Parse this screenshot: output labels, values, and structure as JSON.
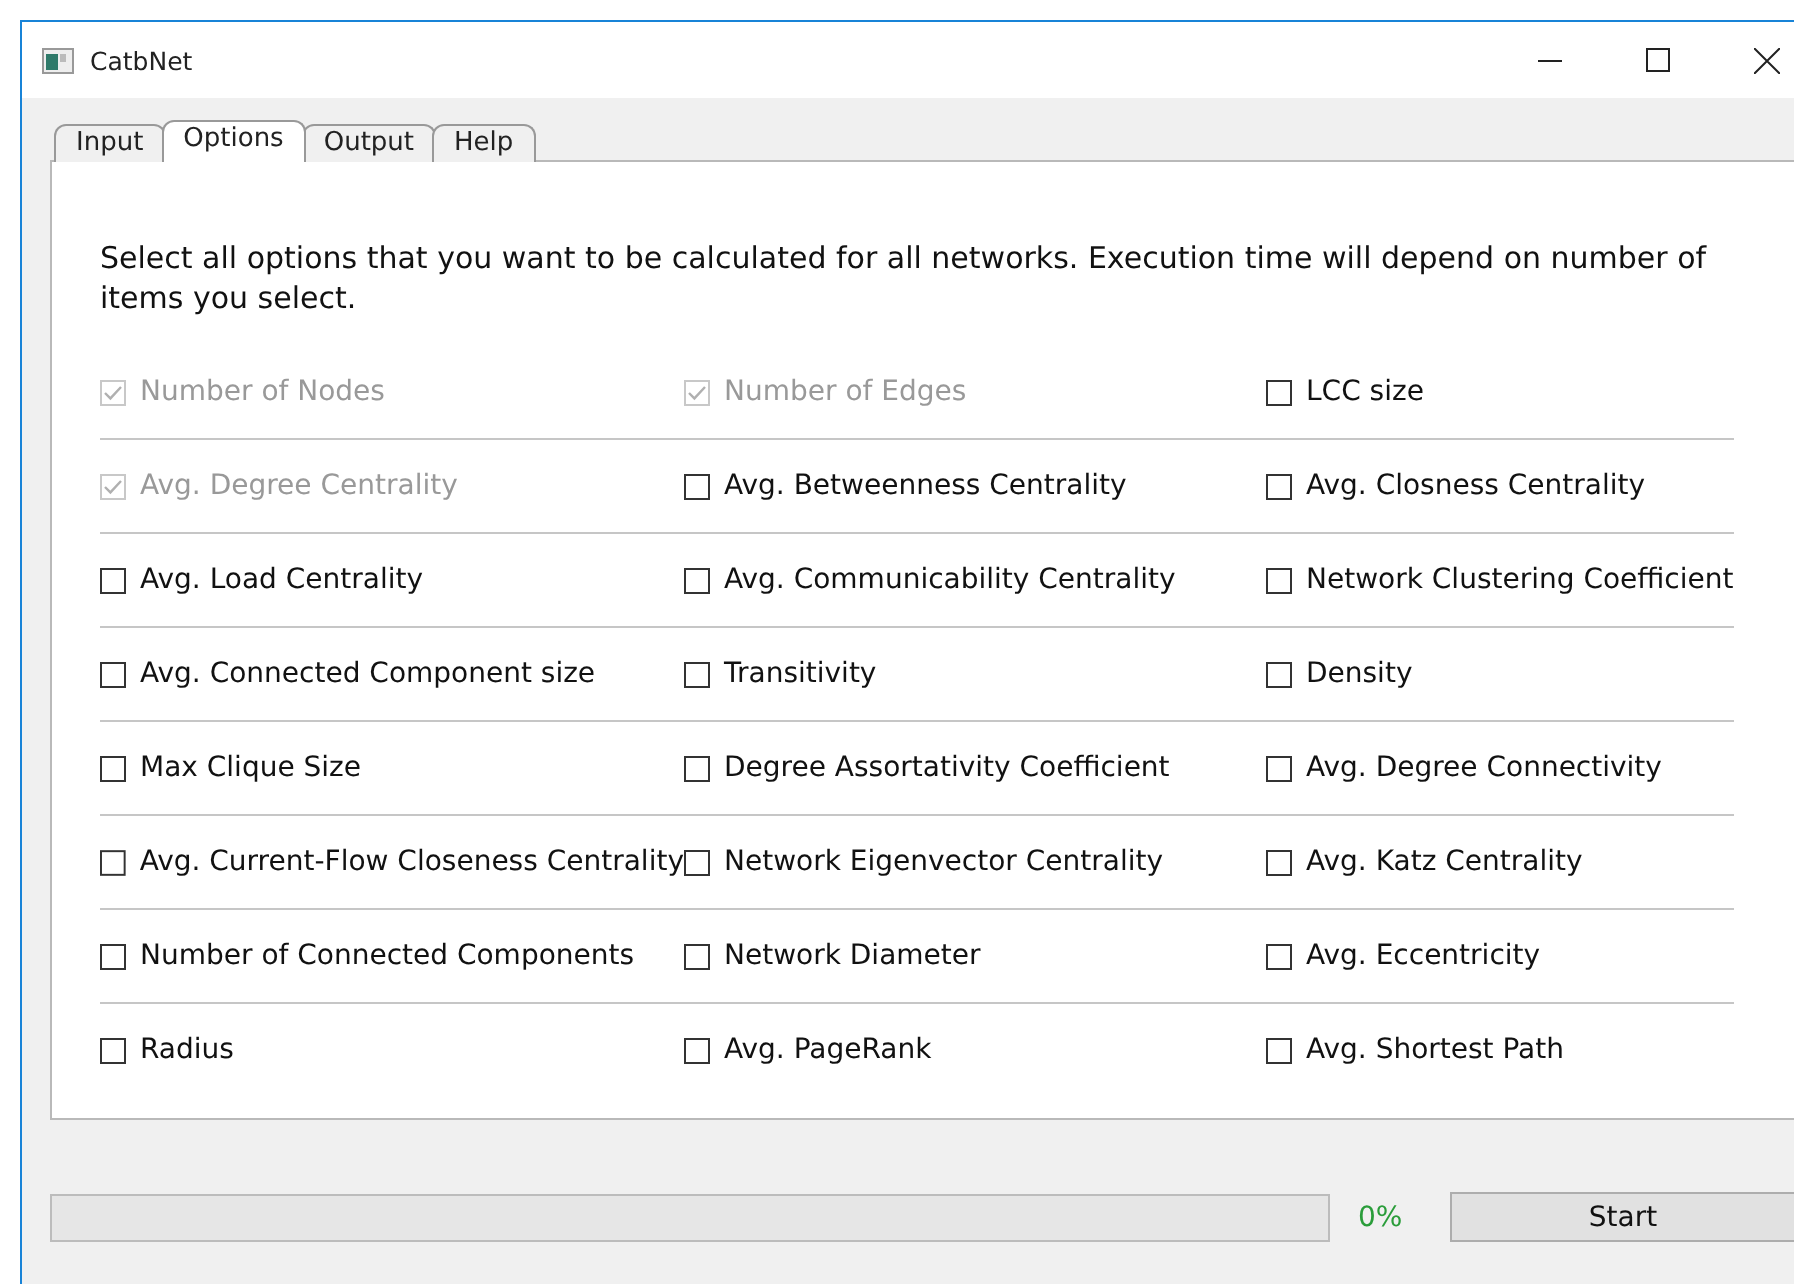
{
  "window": {
    "title": "CatbNet"
  },
  "tabs": [
    {
      "label": "Input",
      "selected": false
    },
    {
      "label": "Options",
      "selected": true
    },
    {
      "label": "Output",
      "selected": false
    },
    {
      "label": "Help",
      "selected": false
    }
  ],
  "instructions": "Select all options that you want to be calculated for all networks. Execution time will depend on number of items you select.",
  "option_rows": [
    [
      {
        "label": "Number of Nodes",
        "checked": true,
        "disabled": true
      },
      {
        "label": "Number of Edges",
        "checked": true,
        "disabled": true
      },
      {
        "label": "LCC size",
        "checked": false,
        "disabled": false
      }
    ],
    [
      {
        "label": "Avg. Degree Centrality",
        "checked": true,
        "disabled": true
      },
      {
        "label": "Avg. Betweenness Centrality",
        "checked": false,
        "disabled": false
      },
      {
        "label": "Avg. Closness Centrality",
        "checked": false,
        "disabled": false
      }
    ],
    [
      {
        "label": "Avg. Load Centrality",
        "checked": false,
        "disabled": false
      },
      {
        "label": "Avg. Communicability Centrality",
        "checked": false,
        "disabled": false
      },
      {
        "label": "Network Clustering Coefficient",
        "checked": false,
        "disabled": false
      }
    ],
    [
      {
        "label": "Avg. Connected Component size",
        "checked": false,
        "disabled": false
      },
      {
        "label": "Transitivity",
        "checked": false,
        "disabled": false
      },
      {
        "label": "Density",
        "checked": false,
        "disabled": false
      }
    ],
    [
      {
        "label": "Max Clique Size",
        "checked": false,
        "disabled": false
      },
      {
        "label": "Degree Assortativity Coefficient",
        "checked": false,
        "disabled": false
      },
      {
        "label": "Avg. Degree Connectivity",
        "checked": false,
        "disabled": false
      }
    ],
    [
      {
        "label": "Avg. Current-Flow Closeness Centrality",
        "checked": false,
        "disabled": false
      },
      {
        "label": "Network Eigenvector Centrality",
        "checked": false,
        "disabled": false
      },
      {
        "label": "Avg. Katz Centrality",
        "checked": false,
        "disabled": false
      }
    ],
    [
      {
        "label": "Number of Connected Components",
        "checked": false,
        "disabled": false
      },
      {
        "label": "Network Diameter",
        "checked": false,
        "disabled": false
      },
      {
        "label": "Avg. Eccentricity",
        "checked": false,
        "disabled": false
      }
    ],
    [
      {
        "label": "Radius",
        "checked": false,
        "disabled": false
      },
      {
        "label": "Avg. PageRank",
        "checked": false,
        "disabled": false
      },
      {
        "label": "Avg. Shortest Path",
        "checked": false,
        "disabled": false
      }
    ]
  ],
  "progress": {
    "level": 0,
    "reading": "0%"
  },
  "start_button": "Start"
}
